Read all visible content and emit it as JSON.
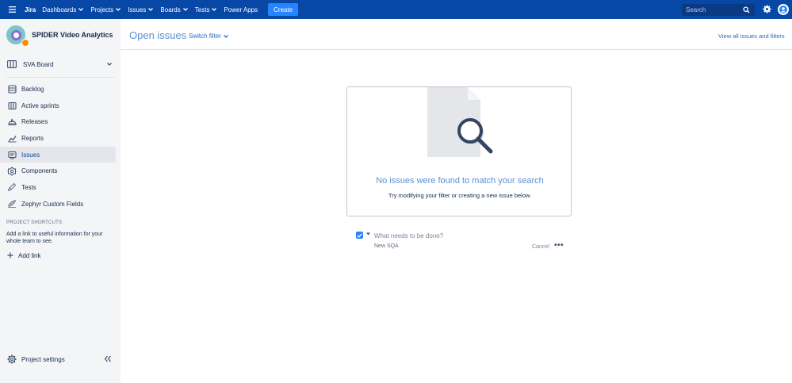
{
  "topnav": {
    "logo": "Jira",
    "items": [
      {
        "label": "Dashboards",
        "has_dropdown": true
      },
      {
        "label": "Projects",
        "has_dropdown": true
      },
      {
        "label": "Issues",
        "has_dropdown": true
      },
      {
        "label": "Boards",
        "has_dropdown": true
      },
      {
        "label": "Tests",
        "has_dropdown": true
      },
      {
        "label": "Power Apps",
        "has_dropdown": false
      }
    ],
    "create_label": "Create",
    "search_placeholder": "Search",
    "brand_color": "#0747a6",
    "create_color": "#2684ff"
  },
  "sidebar": {
    "project_name": "SPIDER Video Analytics",
    "board_selector": "SVA Board",
    "items": [
      {
        "label": "Backlog",
        "icon": "backlog-icon",
        "active": false
      },
      {
        "label": "Active sprints",
        "icon": "sprints-icon",
        "active": false
      },
      {
        "label": "Releases",
        "icon": "releases-icon",
        "active": false
      },
      {
        "label": "Reports",
        "icon": "reports-icon",
        "active": false
      },
      {
        "label": "Issues",
        "icon": "issues-icon",
        "active": true
      },
      {
        "label": "Components",
        "icon": "components-icon",
        "active": false
      },
      {
        "label": "Tests",
        "icon": "tests-icon",
        "active": false
      },
      {
        "label": "Zephyr Custom Fields",
        "icon": "zephyr-icon",
        "active": false
      }
    ],
    "shortcuts_title": "PROJECT SHORTCUTS",
    "shortcuts_desc": "Add a link to useful information for your whole team to see.",
    "add_link": "Add link",
    "project_settings": "Project settings"
  },
  "main": {
    "title": "Open issues",
    "switch_filter": "Switch filter",
    "view_all": "View all issues and filters",
    "empty_title": "No issues were found to match your search",
    "empty_subtitle": "Try modifying your filter or creating a new issue below.",
    "create_placeholder": "What needs to be done?",
    "issue_type": "New SQA",
    "cancel": "Cancel"
  }
}
